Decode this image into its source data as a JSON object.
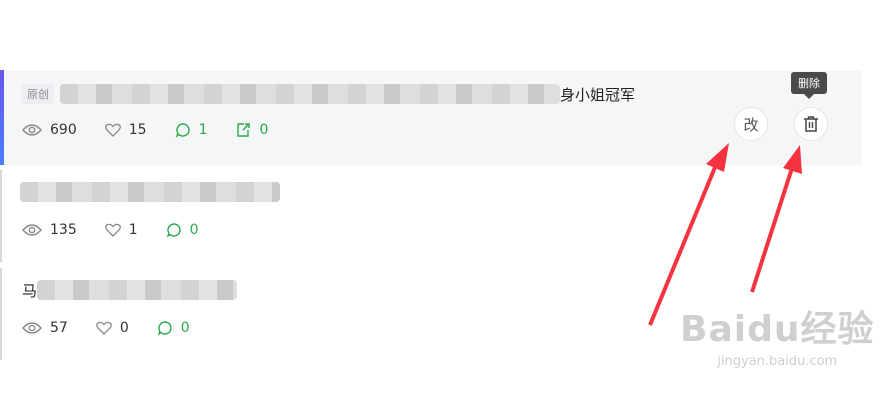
{
  "articles": [
    {
      "tag": "原创",
      "title_suffix": "身小姐冠军",
      "views": "690",
      "likes": "15",
      "comments": "1",
      "shares": "0",
      "edit_label": "改",
      "delete_tooltip": "删除"
    },
    {
      "views": "135",
      "likes": "1",
      "comments": "0"
    },
    {
      "title_prefix": "马",
      "views": "57",
      "likes": "0",
      "comments": "0"
    }
  ],
  "watermark": {
    "main": "Baidu经验",
    "sub": "jingyan.baidu.com"
  },
  "colors": {
    "accent": "#4a7bff",
    "comment_green": "#2ba84a",
    "arrow_red": "#f5333f"
  }
}
